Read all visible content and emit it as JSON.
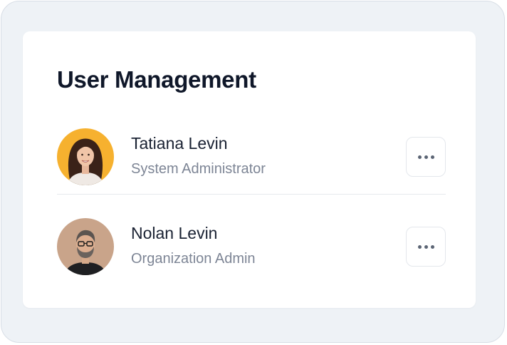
{
  "title": "User Management",
  "users": [
    {
      "name": "Tatiana Levin",
      "role": "System Administrator",
      "avatar_bg": "#f6b12f",
      "menu_icon": "ellipsis-horizontal-icon"
    },
    {
      "name": "Nolan Levin",
      "role": "Organization Admin",
      "avatar_bg": "#c9a48a",
      "menu_icon": "ellipsis-horizontal-icon"
    }
  ],
  "colors": {
    "frame_bg": "#eef2f6",
    "card_bg": "#ffffff",
    "title": "#0f1729",
    "subtitle": "#7d8595"
  }
}
